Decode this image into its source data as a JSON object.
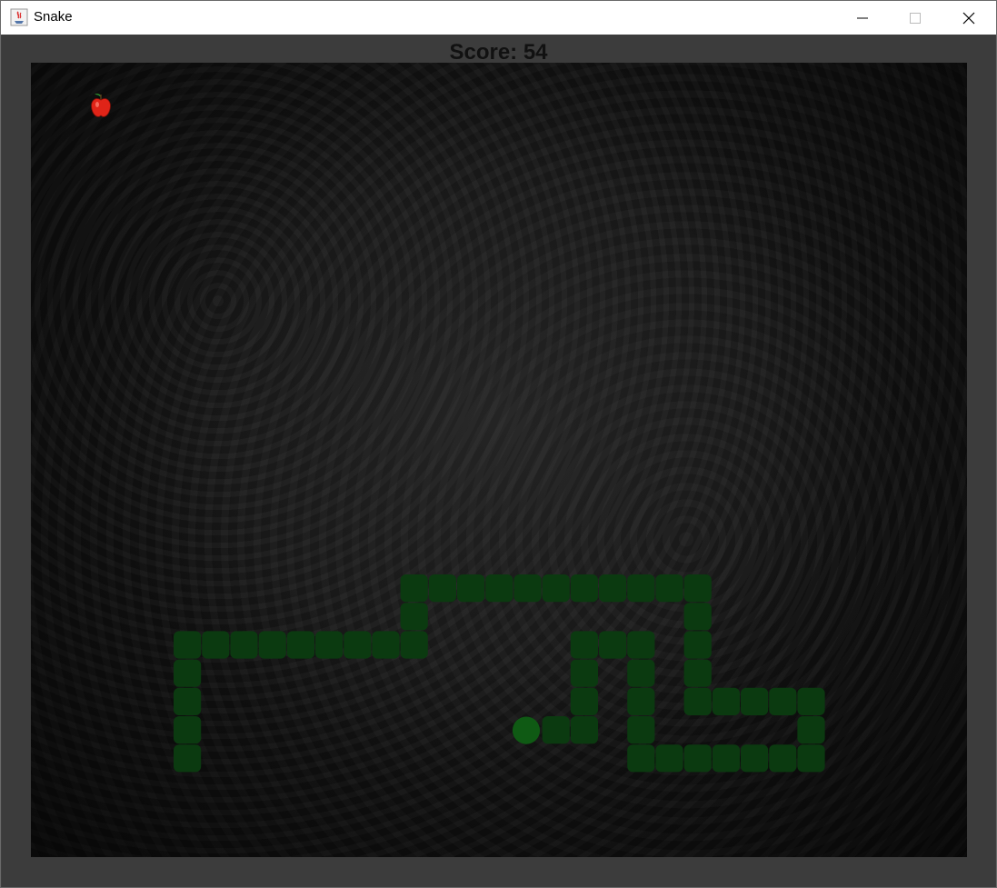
{
  "window": {
    "title": "Snake",
    "app_icon": "java-cup-icon",
    "controls": [
      "minimize-icon",
      "maximize-icon",
      "close-icon"
    ]
  },
  "game": {
    "score_text": "Score: 54",
    "score": 54,
    "colors": {
      "snake_body": "#0b3a10",
      "snake_head": "#0f5a14",
      "apple": "#e02418",
      "board_bg": "#141414"
    },
    "food_icon": "apple-icon"
  }
}
